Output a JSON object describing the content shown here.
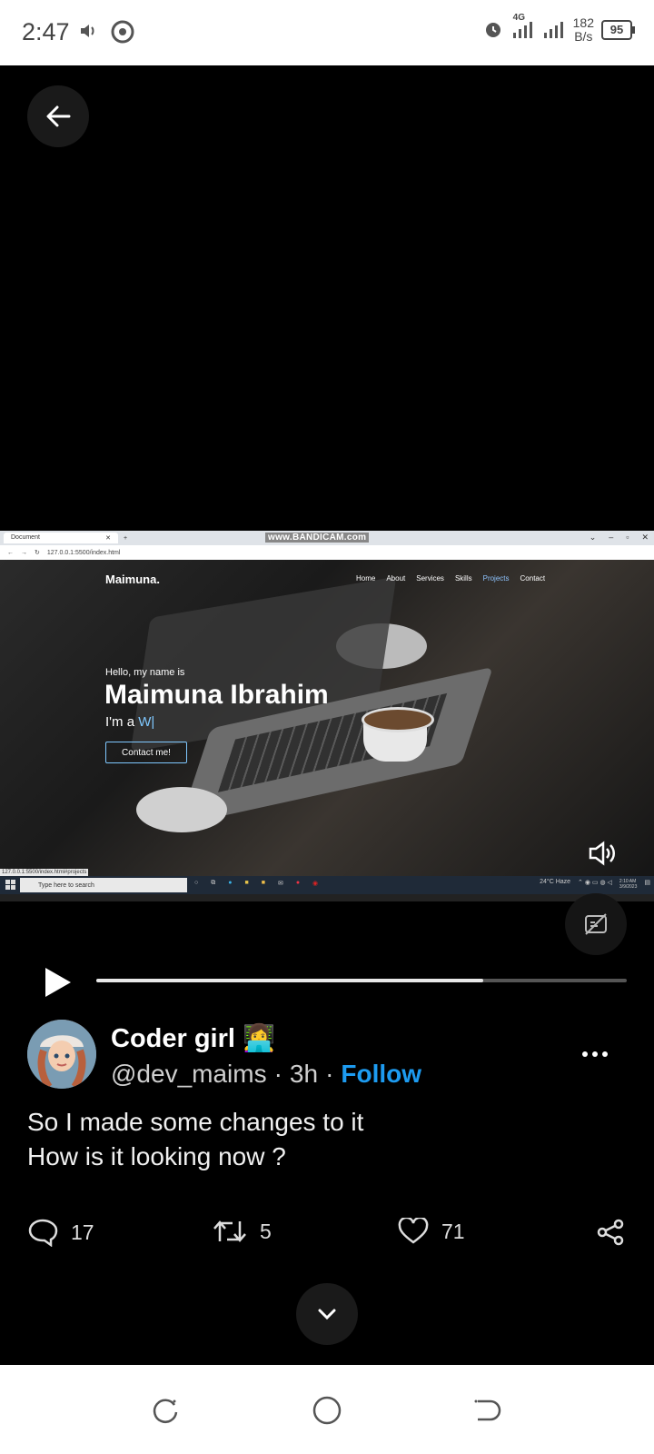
{
  "status_bar": {
    "time": "2:47",
    "network_type": "4G",
    "speed_value": "182",
    "speed_unit": "B/s",
    "battery": "95"
  },
  "video": {
    "watermark": "www.BANDICAM.com",
    "browser_tab_title": "Document",
    "url": "127.0.0.1:5500/index.html",
    "site_logo": "Maimuna.",
    "site_nav": [
      "Home",
      "About",
      "Services",
      "Skills",
      "Projects",
      "Contact"
    ],
    "hero_greeting": "Hello, my name is",
    "hero_name": "Maimuna Ibrahim",
    "hero_prefix": "I'm a ",
    "hero_typed": "W|",
    "hero_button": "Contact me!",
    "status_url": "127.0.0.1:5500/index.html#projects",
    "taskbar_search": "Type here to search",
    "taskbar_weather": "24°C  Haze",
    "taskbar_time": "2:10 AM",
    "taskbar_date": "3/9/2023",
    "progress": 0.73
  },
  "tweet": {
    "display_name": "Coder girl 👩‍💻",
    "handle": "@dev_maims",
    "separator": "·",
    "age": "3h",
    "follow_label": "Follow",
    "text_line1": "So I made some changes to it",
    "text_line2": "How is it looking now ?",
    "replies": "17",
    "retweets": "5",
    "likes": "71"
  },
  "colors": {
    "accent": "#1d9bf0",
    "background": "#000000"
  }
}
